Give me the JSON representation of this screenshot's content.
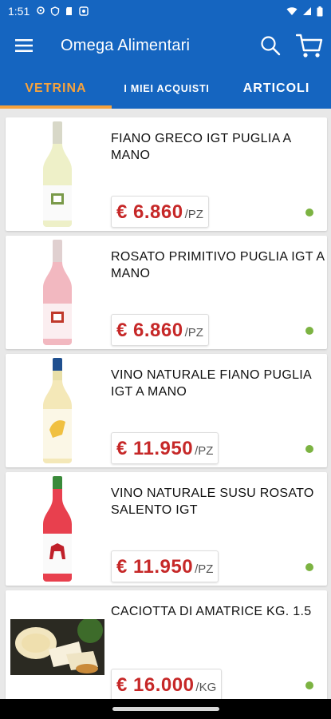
{
  "status_bar": {
    "time": "1:51"
  },
  "app_bar": {
    "title": "Omega Alimentari"
  },
  "tabs": [
    {
      "label": "VETRINA",
      "active": true
    },
    {
      "label": "I MIEI ACQUISTI",
      "active": false
    },
    {
      "label": "ARTICOLI",
      "active": false
    }
  ],
  "products": [
    {
      "name": "FIANO GRECO IGT PUGLIA A MANO",
      "price": "€ 6.860",
      "unit": "/PZ",
      "image": "white-wine-bottle"
    },
    {
      "name": "ROSATO PRIMITIVO PUGLIA IGT A MANO",
      "price": "€ 6.860",
      "unit": "/PZ",
      "image": "rose-wine-bottle"
    },
    {
      "name": "VINO NATURALE FIANO PUGLIA IGT A MANO",
      "price": "€ 11.950",
      "unit": "/PZ",
      "image": "natural-wine-bottle"
    },
    {
      "name": "VINO NATURALE SUSU ROSATO SALENTO IGT",
      "price": "€ 11.950",
      "unit": "/PZ",
      "image": "red-wine-bottle"
    },
    {
      "name": "CACIOTTA DI AMATRICE KG. 1.5",
      "price": "€ 16.000",
      "unit": "/KG",
      "image": "cheese-photo"
    }
  ],
  "colors": {
    "primary": "#1565c0",
    "accent": "#f5a23d",
    "price": "#c62828",
    "available_dot": "#7cb342"
  }
}
